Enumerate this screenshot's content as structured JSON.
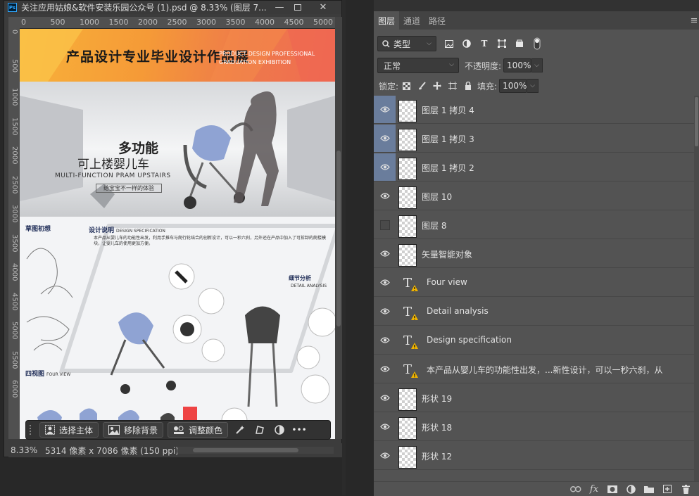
{
  "document": {
    "title": "关注应用姑娘&软件安装乐园公众号 (1).psd @ 8.33% (图层 7...",
    "badge": "Ps",
    "ruler_h": [
      "0",
      "500",
      "1000",
      "1500",
      "2000",
      "2500",
      "3000",
      "3500",
      "4000",
      "4500",
      "5000"
    ],
    "ruler_v": [
      "0",
      "500",
      "1000",
      "1500",
      "2000",
      "2500",
      "3000",
      "3500",
      "4000",
      "4500",
      "5000",
      "5500",
      "6000"
    ],
    "poster": {
      "header_zh": "产品设计专业毕业设计作品展",
      "header_en": "PRODUCT DESIGN PROFESSIONAL GRADUATION EXHIBITION",
      "hero_title1": "多功能",
      "hero_title2": "可上楼婴儿车",
      "hero_title3": "MULTI-FUNCTION PRAM UPSTAIRS",
      "hero_title4": "给宝宝不一样的体验",
      "sec_sketch": "草图初想",
      "sec_design": "设计说明",
      "sec_design_en": "DESIGN SPECIFICATION",
      "sec_design_text": "本产品从婴儿车的功能性出发，利用手推车与爬行轮结合的创新设计，可以一秒六刹，另外还在产品中加入了可拆卸的爬楼模块，让婴儿车的使用更加方便。",
      "sec_detail": "细节分析",
      "sec_detail_en": "DETAIL ANALYSIS",
      "sec_four": "四视图",
      "sec_four_en": "FOUR VIEW"
    }
  },
  "context_bar": {
    "select_subject": "选择主体",
    "remove_bg": "移除背景",
    "adjust_color": "调整颜色"
  },
  "status": {
    "zoom": "8.33%",
    "info": "5314 像素 x 7086 像素 (150 ppi)",
    "arrow": "›"
  },
  "panel": {
    "tabs": [
      "图层",
      "通道",
      "路径"
    ],
    "kind_label": "类型",
    "blend_mode": "正常",
    "opacity_label": "不透明度:",
    "opacity_value": "100%",
    "lock_label": "锁定:",
    "fill_label": "填充:",
    "fill_value": "100%",
    "layers": [
      {
        "name": "图层 1 拷贝 4",
        "type": "pixel",
        "visible": true,
        "selected": true
      },
      {
        "name": "图层 1 拷贝 3",
        "type": "pixel",
        "visible": true,
        "selected": true
      },
      {
        "name": "图层 1 拷贝 2",
        "type": "pixel",
        "visible": true,
        "selected": true
      },
      {
        "name": "图层 10",
        "type": "pixel",
        "visible": true,
        "selected": false
      },
      {
        "name": "图层 8",
        "type": "pixel",
        "visible": false,
        "selected": false
      },
      {
        "name": "矢量智能对象",
        "type": "smart",
        "visible": true,
        "selected": false
      },
      {
        "name": "Four view",
        "type": "text",
        "visible": true,
        "selected": false
      },
      {
        "name": "Detail analysis",
        "type": "text",
        "visible": true,
        "selected": false
      },
      {
        "name": "Design specification",
        "type": "text",
        "visible": true,
        "selected": false
      },
      {
        "name": "本产品从婴儿车的功能性出发，...新性设计，可以一秒六刹，从",
        "type": "text",
        "visible": true,
        "selected": false
      },
      {
        "name": "形状 19",
        "type": "pixel",
        "visible": true,
        "selected": false
      },
      {
        "name": "形状 18",
        "type": "pixel",
        "visible": true,
        "selected": false
      },
      {
        "name": "形状 12",
        "type": "pixel",
        "visible": true,
        "selected": false
      }
    ]
  },
  "colors": {
    "selection": "#6a7d9c",
    "panel_bg": "#535353",
    "ps_blue": "#31a8ff",
    "warning": "#f0b400"
  }
}
